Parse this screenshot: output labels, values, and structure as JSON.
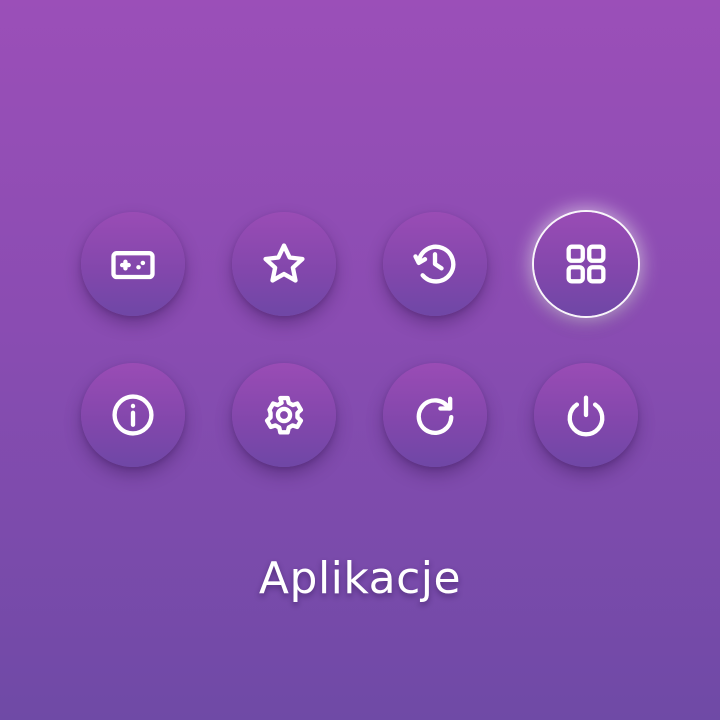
{
  "menu": {
    "buttons": [
      {
        "icon": "gamepad-icon",
        "selected": false
      },
      {
        "icon": "star-icon",
        "selected": false
      },
      {
        "icon": "history-icon",
        "selected": false
      },
      {
        "icon": "apps-grid-icon",
        "selected": true
      },
      {
        "icon": "info-icon",
        "selected": false
      },
      {
        "icon": "gear-icon",
        "selected": false
      },
      {
        "icon": "refresh-icon",
        "selected": false
      },
      {
        "icon": "power-icon",
        "selected": false
      }
    ],
    "selected_label": "Aplikacje"
  },
  "colors": {
    "background_top": "#9b4fb8",
    "background_bottom": "#6f4aa6",
    "icon": "#ffffff",
    "selection_glow": "#ffffff"
  }
}
